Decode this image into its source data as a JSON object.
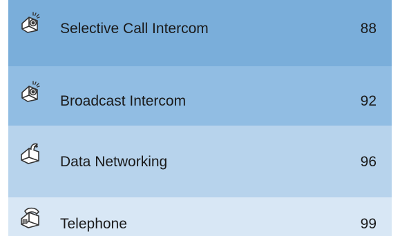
{
  "toc": {
    "entries": [
      {
        "title": "Selective Call Intercom",
        "page": "88",
        "icon": "intercom-house-icon"
      },
      {
        "title": "Broadcast Intercom",
        "page": "92",
        "icon": "intercom-house-icon"
      },
      {
        "title": "Data Networking",
        "page": "96",
        "icon": "satellite-house-icon"
      },
      {
        "title": "Telephone",
        "page": "99",
        "icon": "telephone-house-icon"
      }
    ],
    "colors": {
      "row_1": "#7aaeda",
      "row_2": "#91bde3",
      "row_3": "#b7d3ec",
      "row_4": "#d8e7f5",
      "text": "#1a1a1a"
    }
  }
}
